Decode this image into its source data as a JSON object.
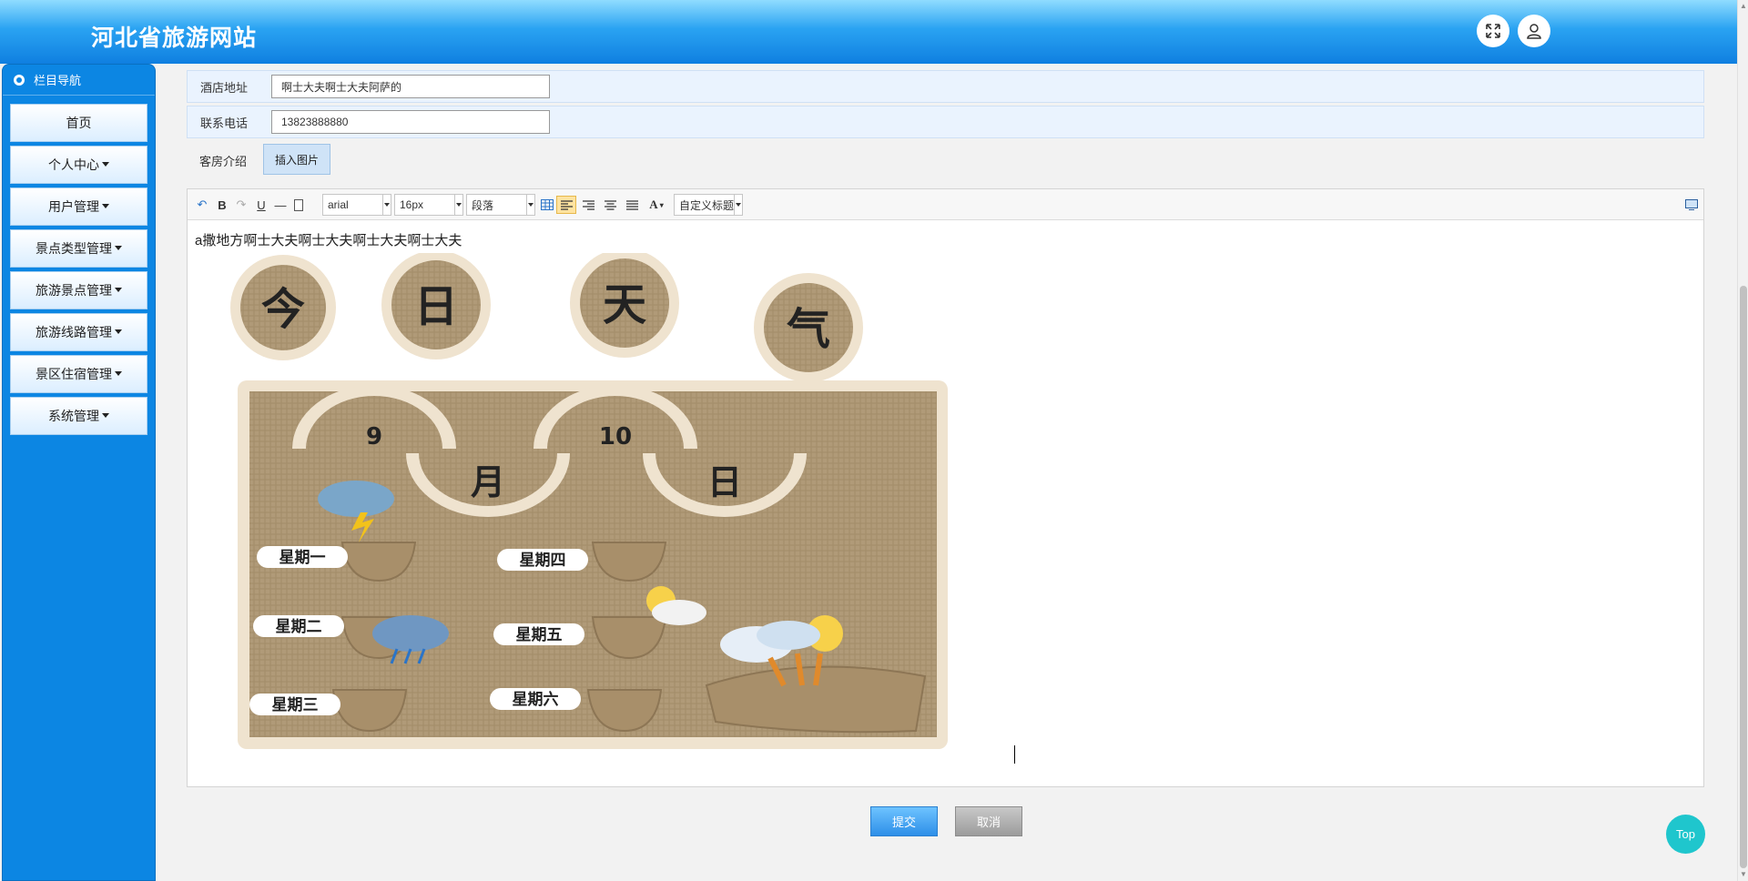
{
  "header": {
    "title": "河北省旅游网站",
    "fullscreen_icon": "fullscreen-icon",
    "user_icon": "user-icon"
  },
  "sidebar": {
    "heading": "栏目导航",
    "items": [
      {
        "label": "首页",
        "has_caret": false
      },
      {
        "label": "个人中心",
        "has_caret": true
      },
      {
        "label": "用户管理",
        "has_caret": true
      },
      {
        "label": "景点类型管理",
        "has_caret": true
      },
      {
        "label": "旅游景点管理",
        "has_caret": true
      },
      {
        "label": "旅游线路管理",
        "has_caret": true
      },
      {
        "label": "景区住宿管理",
        "has_caret": true
      },
      {
        "label": "系统管理",
        "has_caret": true
      }
    ]
  },
  "form": {
    "address": {
      "label": "酒店地址",
      "value": "啊士大夫啊士大夫阿萨的"
    },
    "phone": {
      "label": "联系电话",
      "value": "13823888880"
    },
    "intro": {
      "label": "客房介绍",
      "insert_button": "插入图片"
    }
  },
  "editor": {
    "toolbar": {
      "font_family": "arial",
      "font_size": "16px",
      "paragraph": "段落",
      "custom_heading": "自定义标题",
      "bold": "B",
      "underline": "U",
      "font_color": "A"
    },
    "content_text": "a撒地方啊士大夫啊士大夫啊士大夫啊士大夫",
    "image": {
      "title_chars": [
        "今",
        "日",
        "天",
        "气"
      ],
      "month_num": "9",
      "day_num": "10",
      "month_char": "月",
      "day_char": "日",
      "weekdays": [
        "星期一",
        "星期二",
        "星期三",
        "星期四",
        "星期五",
        "星期六"
      ]
    }
  },
  "actions": {
    "submit": "提交",
    "cancel": "取消",
    "top": "Top"
  }
}
